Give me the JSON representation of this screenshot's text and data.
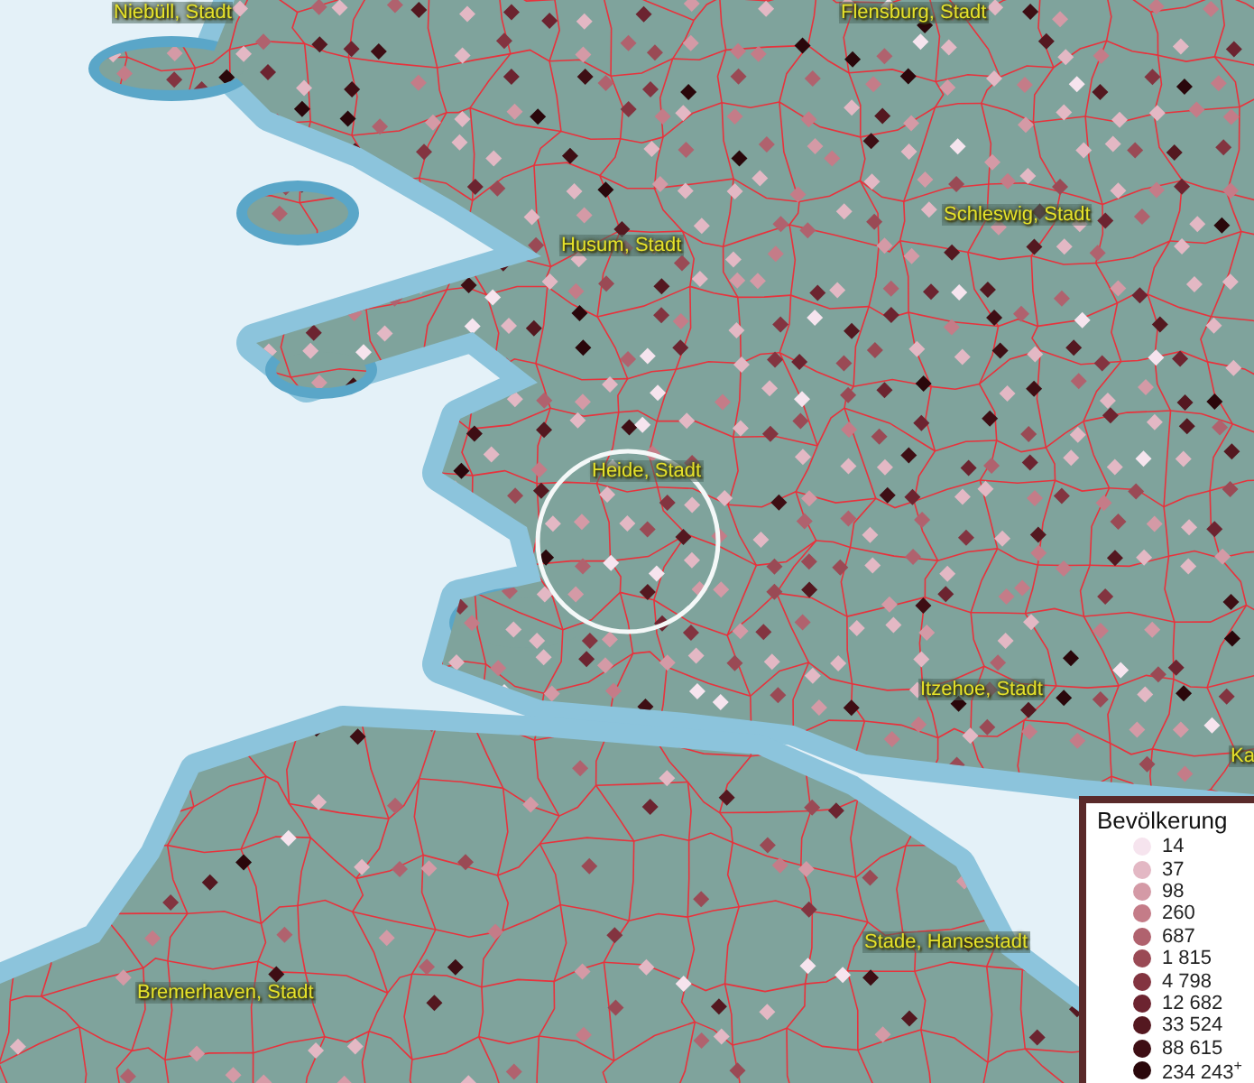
{
  "map": {
    "places": [
      {
        "name": "Niebüll, Stadt"
      },
      {
        "name": "Flensburg, Stadt"
      },
      {
        "name": "Husum, Stadt"
      },
      {
        "name": "Schleswig, Stadt"
      },
      {
        "name": "Heide, Stadt"
      },
      {
        "name": "Itzehoe, Stadt"
      },
      {
        "name": "Stade, Hansestadt"
      },
      {
        "name": "Bremerhaven, Stadt"
      },
      {
        "name": "Ka"
      }
    ]
  },
  "legend": {
    "title": "Bevölkerung",
    "items": [
      {
        "label": "14",
        "color": "#f6e4ee"
      },
      {
        "label": "37",
        "color": "#e3b8c4"
      },
      {
        "label": "98",
        "color": "#d49aa6"
      },
      {
        "label": "260",
        "color": "#c47c88"
      },
      {
        "label": "687",
        "color": "#b0626e"
      },
      {
        "label": "1 815",
        "color": "#9a4a55"
      },
      {
        "label": "4 798",
        "color": "#833440"
      },
      {
        "label": "12 682",
        "color": "#6c2430"
      },
      {
        "label": "33 524",
        "color": "#541820"
      },
      {
        "label": "88 615",
        "color": "#3e0e14"
      },
      {
        "label": "234 243$^{+}$",
        "color": "#2a070b"
      }
    ]
  }
}
